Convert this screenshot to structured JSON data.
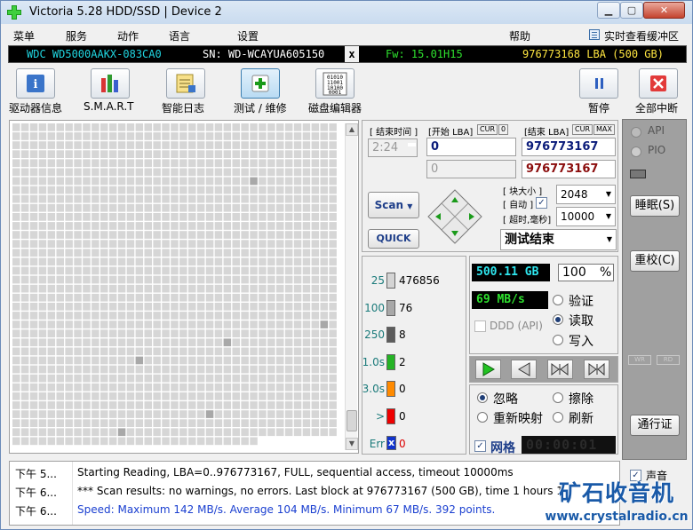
{
  "window": {
    "title": "Victoria 5.28 HDD/SSD | Device 2"
  },
  "menu": {
    "items": [
      "菜单",
      "服务",
      "动作",
      "语言",
      "设置",
      "帮助"
    ],
    "realtime_buffer": "实时查看缓冲区"
  },
  "infobar": {
    "model": "WDC WD5000AAKX-083CA0",
    "serial": "SN: WD-WCAYUA605150",
    "x": "x",
    "firmware": "Fw: 15.01H15",
    "capacity": "976773168 LBA (500 GB)"
  },
  "toolbar": {
    "drive_info": "驱动器信息",
    "smart": "S.M.A.R.T",
    "smart_log": "智能日志",
    "test_repair": "测试 / 维修",
    "disk_editor": "磁盘编辑器",
    "pause": "暂停",
    "abort_all": "全部中断"
  },
  "scan_params": {
    "end_time_label": "[ 结束时间 ]",
    "time_value": "2:24",
    "start_lba_label": "[开始 LBA]",
    "cur_tag": "CUR",
    "zero_tag": "0",
    "end_lba_label": "[结束 LBA]",
    "max_tag": "MAX",
    "start_lba": "0",
    "end_lba": "976773167",
    "start_lba_2": "0",
    "end_lba_2": "976773167",
    "block_size_label": "[ 块大小 ]",
    "auto_label": "[ 自动 ]",
    "block_size": "2048",
    "timeout_label": "[ 超时,毫秒]",
    "timeout": "10000",
    "scan_button": "Scan",
    "quick_button": "QUICK",
    "status": "测试结束"
  },
  "stats": {
    "counters": [
      {
        "label": "25",
        "value": "476856",
        "color": "#d4d4d4"
      },
      {
        "label": "100",
        "value": "76",
        "color": "#a8a8a8"
      },
      {
        "label": "250",
        "value": "8",
        "color": "#5c5c5c"
      },
      {
        "label": "1.0s",
        "value": "2",
        "color": "#25b325"
      },
      {
        "label": "3.0s",
        "value": "0",
        "color": "#ff8a00"
      },
      {
        "label": ">",
        "value": "0",
        "color": "#ee0000"
      },
      {
        "label": "Err",
        "value": "0",
        "color": "#1133cc"
      }
    ],
    "err_x": "x",
    "size_done": "500.11 GB",
    "percent": "100",
    "percent_sign": "%",
    "speed": "69 MB/s",
    "ddd_api": "DDD (API)",
    "mode_verify": "验证",
    "mode_read": "读取",
    "mode_write": "写入",
    "opt_ignore": "忽略",
    "opt_erase": "擦除",
    "opt_remap": "重新映射",
    "opt_refresh": "刷新",
    "grid_label": "网格",
    "timer": "00:00:01"
  },
  "right": {
    "api": "API",
    "pio": "PIO",
    "sleep": "睡眠(S)",
    "recal": "重校(C)",
    "wr": "WR",
    "rd": "RD",
    "passport": "通行证",
    "sound": "声音"
  },
  "log": [
    {
      "time": "下午 5...",
      "msg": "Starting Reading, LBA=0..976773167, FULL, sequential access, timeout 10000ms",
      "color": "#000000"
    },
    {
      "time": "下午 6...",
      "msg": "*** Scan results: no warnings, no errors. Last block at 976773167 (500 GB), time 1 hours 1",
      "color": "#000000"
    },
    {
      "time": "下午 6...",
      "msg": "Speed: Maximum 142 MB/s. Average 104 MB/s. Minimum 67 MB/s. 392 points.",
      "color": "#1a3fd0"
    }
  ],
  "watermark": {
    "text": "矿石收音机",
    "url": "www.crystalradio.cn"
  }
}
